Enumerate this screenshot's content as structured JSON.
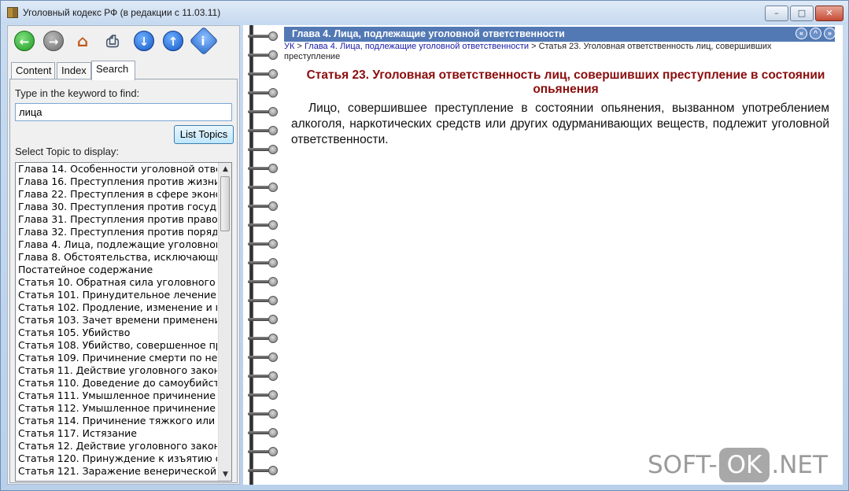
{
  "window": {
    "title": "Уголовный кодекс РФ (в редакции с 11.03.11)",
    "buttons": {
      "minimize": "–",
      "maximize": "□",
      "close": "✕"
    }
  },
  "toolbar": {
    "back": "←",
    "forward": "→",
    "home": "⌂",
    "print": "⎙",
    "down": "↓",
    "up": "↑",
    "info": "i"
  },
  "tabs": [
    "Content",
    "Index",
    "Search"
  ],
  "search": {
    "keyword_label": "Type in the keyword to find:",
    "keyword_value": "лица",
    "list_topics_button": "List Topics",
    "select_label": "Select Topic to display:",
    "topics": [
      "Глава 14. Особенности уголовной отве",
      "Глава 16. Преступления против жизни",
      "Глава 22. Преступления в сфере эконо",
      "Глава 30. Преступления против госуда",
      "Глава 31. Преступления против правос",
      "Глава 32. Преступления против порядк",
      "Глава 4. Лица, подлежащие уголовной с",
      "Глава 8. Обстоятельства, исключающие",
      "Постатейное содержание",
      "Статья 10. Обратная сила уголовного з",
      "Статья 101. Принудительное лечение в",
      "Статья 102. Продление, изменение и пр",
      "Статья 103. Зачет времени применения",
      "Статья 105. Убийство",
      "Статья 108. Убийство, совершенное при",
      "Статья 109. Причинение смерти по нео",
      "Статья 11. Действие уголовного закона",
      "Статья 110. Доведение до самоубийст",
      "Статья 111. Умышленное причинение т",
      "Статья 112. Умышленное причинение ср",
      "Статья 114. Причинение тяжкого или ср",
      "Статья 117. Истязание",
      "Статья 12. Действие уголовного закона",
      "Статья 120. Принуждение к изъятию ор",
      "Статья 121. Заражение венерической б"
    ]
  },
  "content": {
    "chapter_header": "Глава 4. Лица, подлежащие уголовной ответственности",
    "nav": {
      "prev": "«",
      "up": "^",
      "next": "»"
    },
    "breadcrumb": {
      "root": "УК",
      "sep": " > ",
      "chapter": "Глава 4. Лица, подлежащие уголовной ответственности",
      "current": "Статья 23. Уголовная ответственность лиц, совершивших преступление"
    },
    "article_title": "Статья 23. Уголовная ответственность лиц, совершивших преступление в состоянии опьянения",
    "article_body": "Лицо, совершившее преступление в состоянии опьянения, вызванном употреблением алкоголя, наркотических средств или других одурманивающих веществ, подлежит уголовной ответственности."
  },
  "watermark": {
    "left": "SOFT-",
    "mid": "OK",
    "right": ".NET"
  }
}
